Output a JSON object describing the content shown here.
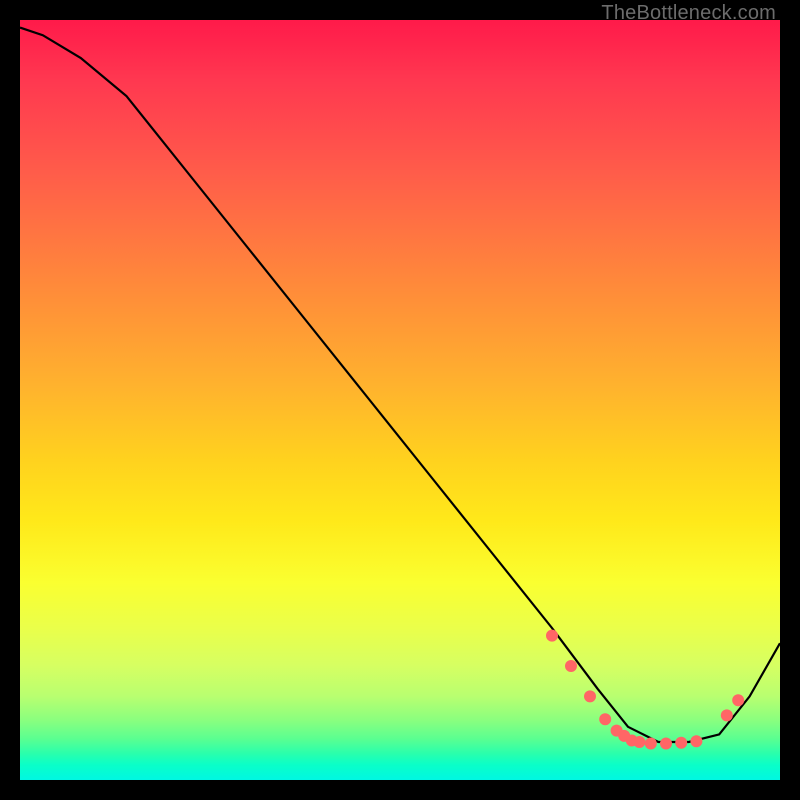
{
  "watermark": "TheBottleneck.com",
  "chart_data": {
    "type": "line",
    "title": "",
    "xlabel": "",
    "ylabel": "",
    "xlim": [
      0,
      100
    ],
    "ylim": [
      0,
      100
    ],
    "series": [
      {
        "name": "curve",
        "x": [
          0,
          3,
          8,
          14,
          22,
          30,
          38,
          46,
          54,
          62,
          70,
          76,
          80,
          84,
          88,
          92,
          96,
          100
        ],
        "y": [
          99,
          98,
          95,
          90,
          80,
          70,
          60,
          50,
          40,
          30,
          20,
          12,
          7,
          5,
          5,
          6,
          11,
          18
        ]
      }
    ],
    "markers": {
      "name": "dots",
      "color": "#ff6666",
      "x": [
        70,
        72.5,
        75,
        77,
        78.5,
        79.5,
        80.5,
        81.5,
        83,
        85,
        87,
        89,
        93,
        94.5
      ],
      "y": [
        19,
        15,
        11,
        8,
        6.5,
        5.8,
        5.2,
        5.0,
        4.8,
        4.8,
        4.9,
        5.1,
        8.5,
        10.5
      ]
    }
  }
}
